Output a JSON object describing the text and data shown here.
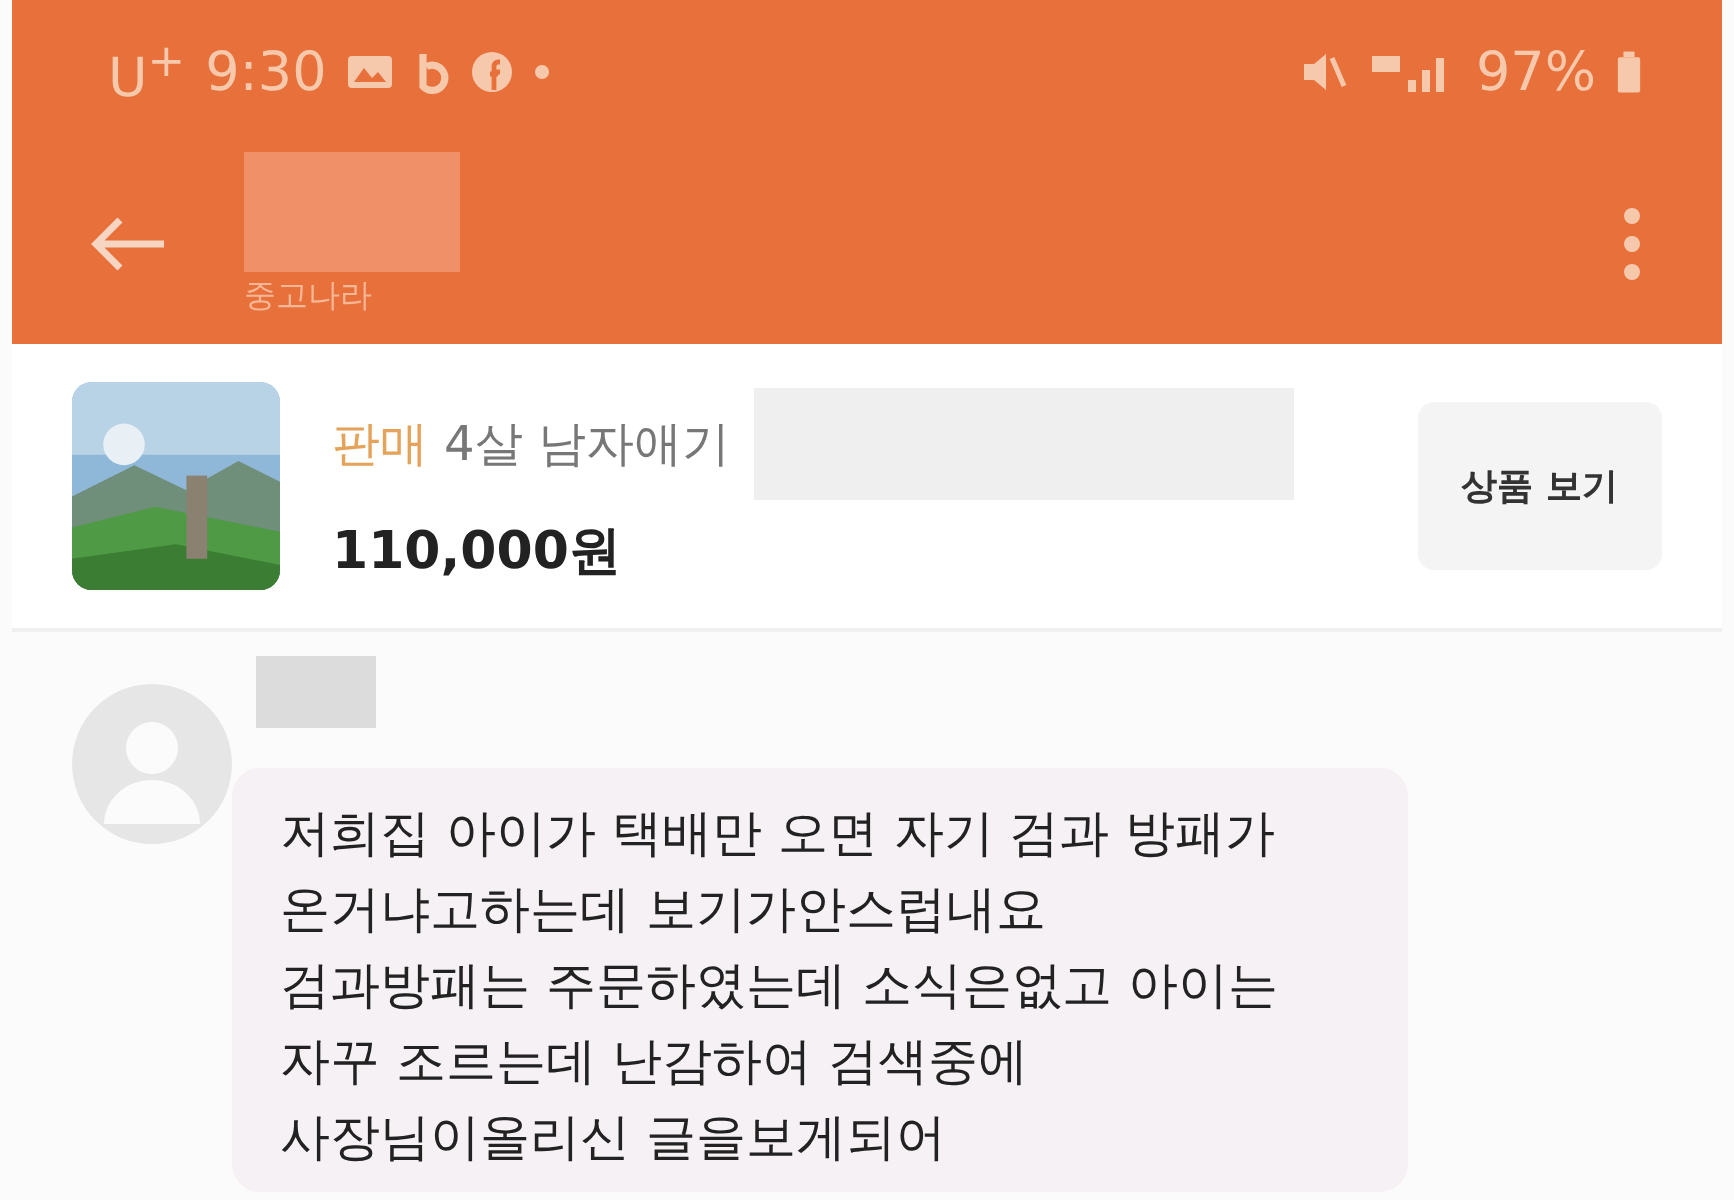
{
  "status_bar": {
    "carrier": "U$^{+}$",
    "time": "9:30",
    "battery": "97%"
  },
  "header": {
    "subtitle": "중고나라"
  },
  "product": {
    "tag": "판매",
    "title": "4살 남자애기",
    "price": "110,000원",
    "button": "상품 보기"
  },
  "messages": [
    {
      "text": "저희집  아이가 택배만 오면  자기 검과 방패가\n온거냐고하는데 보기가안스럽내요\n검과방패는  주문하였는데 소식은없고 아이는\n자꾸 조르는데 난감하여  검색중에\n사장님이올리신  글을보게되어"
    }
  ]
}
